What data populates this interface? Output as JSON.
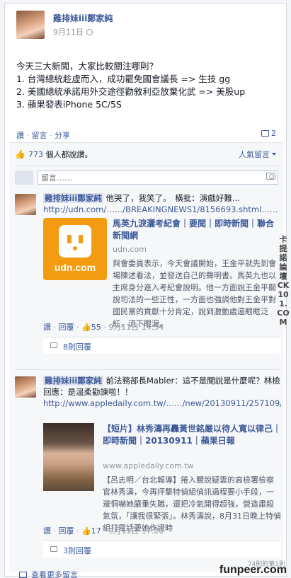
{
  "post": {
    "author": "雞排妹iii鄭家純",
    "date": "9月11日",
    "lines": [
      "今天三大新聞，大家比較關注哪則？",
      "1. 台灣總統趁虛而入，成功罷免國會議長 => 生技 gg",
      "2. 美國總統承諾用外交途徑勸敘利亞放棄化武 => 美股up",
      "3. 蘋果發表iPhone 5C/5S"
    ],
    "actions": {
      "like": "讚",
      "comment": "留言",
      "share": "分享"
    },
    "comment_count": "2"
  },
  "feedback": {
    "likes_count": "773",
    "likes_text": "個人都說讚。",
    "sort_label": "人氣留言",
    "comment_placeholder": "留言……"
  },
  "comments": [
    {
      "author": "雞排妹iii鄭家純",
      "text": "他哭了，我笑了。　橫批：演戲好難…",
      "link": "http://udn.com/……/BREAKINGNEWS1/8156693.shtml……",
      "preview": {
        "logo_text": "udn.com",
        "title": "馬英九淚灑考紀會｜要聞｜即時新聞｜聯合新聞網",
        "domain": "udn.com",
        "desc": "與會委員表示，今天會議開始，王金平就先到會場陳述看法，並發送自己的聲明書。馬英九也以主席身分進入考紀會說明。他一方面說王金平關說司法的一些正性，一方面也強調他對王金平對國民黨的貢獻十分肯定，說到激動處還眼眶泛紅，流下眼淚。"
      },
      "meta": {
        "like": "讚",
        "reply": "回覆",
        "likes": "55",
        "time": "9月11日 14:54"
      },
      "replies": "8則回覆"
    },
    {
      "author": "雞排妹iii鄭家純",
      "text": "前法務部長Mabler：這不是關說是什麼呢？林檢回應：是溫柔勸諫啦！！",
      "link": "http://www.appledaily.com.tw/……/new/20130911/257109/",
      "preview": {
        "title": "【短片】林秀濤再轟黃世銘嚴以待人寬以律己｜即時新聞｜20130911｜蘋果日報",
        "domain": "www.appledaily.com.tw",
        "desc": "【呂志明／台北報導】捲入關說疑雲的高檢署檢察官林秀濤，今再抨擊特偵組偵訊過程要小手段，一邊恫嚇她嚴重失職，還把冷氣開得超強，營造肅殺氣氛，「讓我很緊張」。林秀濤說，8月31日晚上特偵組打電話要她作證時"
      },
      "meta": {
        "like": "讚",
        "reply": "回覆",
        "likes": "17",
        "time": "9月11日 17:20"
      },
      "replies": "3則回覆"
    }
  ],
  "more_comments": "查看更多留言",
  "watermarks": {
    "side": "卡提諾論壇 CK101.COM",
    "bottom": "funpeer.com",
    "page": "74則的第1則"
  }
}
